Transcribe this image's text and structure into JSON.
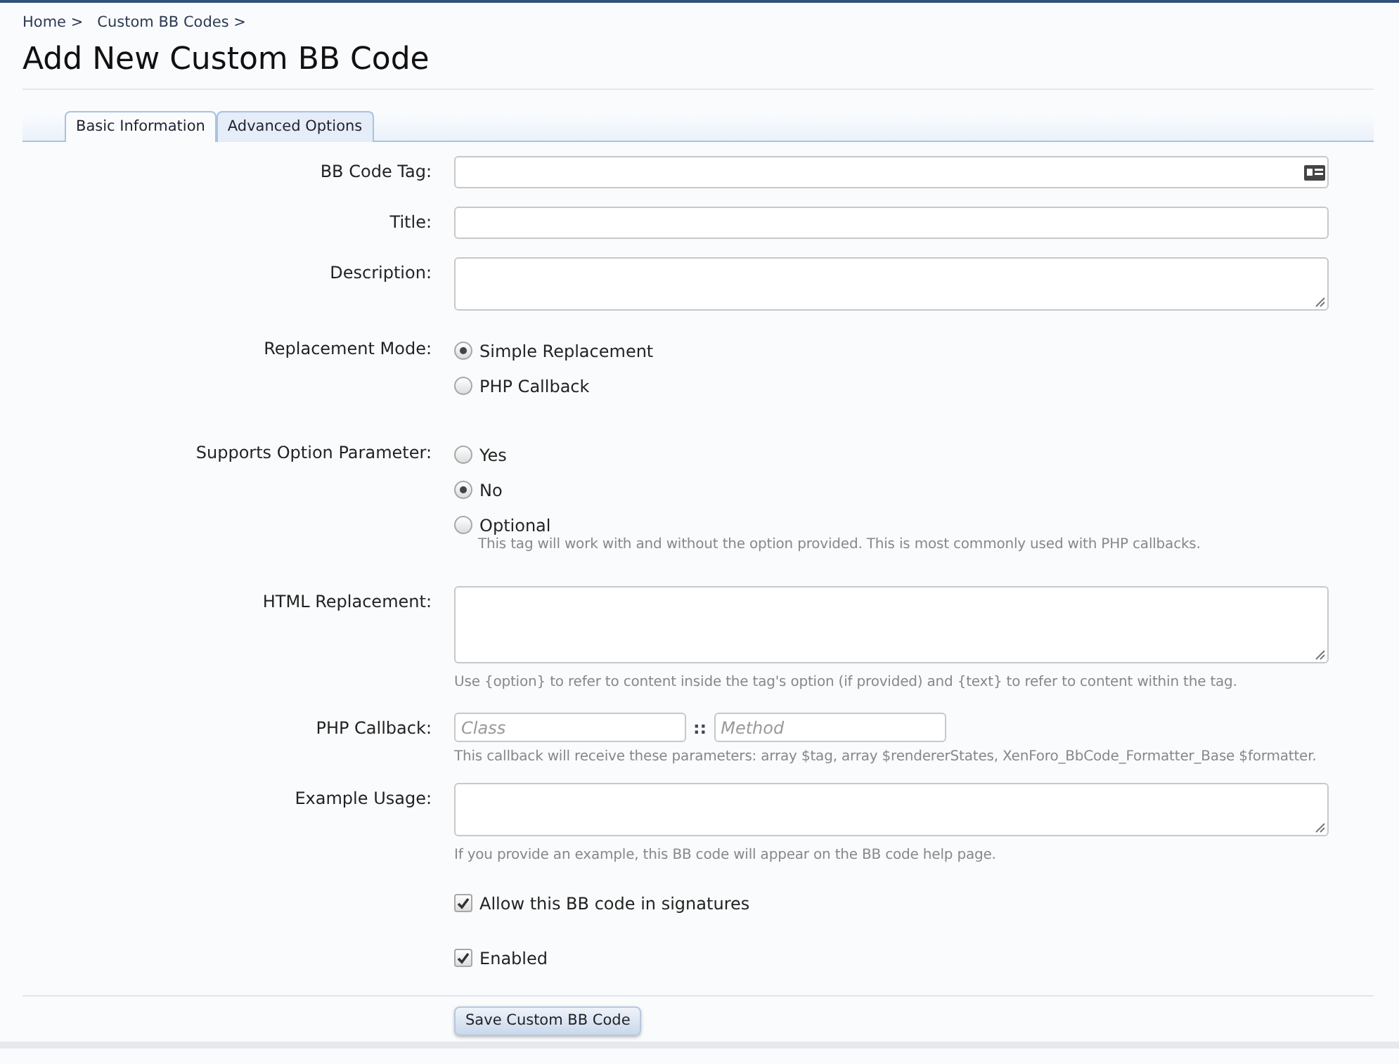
{
  "breadcrumb": [
    "Home >",
    "Custom BB Codes >"
  ],
  "title": "Add New Custom BB Code",
  "tabs": [
    {
      "label": "Basic Information",
      "selected": true
    },
    {
      "label": "Advanced Options",
      "selected": false
    }
  ],
  "fields": [
    {
      "kind": "tag",
      "label": "BB Code Tag:"
    },
    {
      "kind": "text",
      "label": "Title:"
    },
    {
      "kind": "textarea",
      "label": "Description:"
    },
    {
      "kind": "radio",
      "label": "Replacement Mode:",
      "options": [
        {
          "label": "Simple Replacement",
          "selected": true
        },
        {
          "label": "PHP Callback",
          "selected": false
        }
      ]
    },
    {
      "kind": "radio",
      "label": "Supports Option Parameter:",
      "options": [
        {
          "label": "Yes",
          "selected": false
        },
        {
          "label": "No",
          "selected": true
        },
        {
          "label": "Optional",
          "selected": false
        }
      ],
      "hint": "This tag will work with and without the option provided. This is most commonly used with PHP callbacks."
    },
    {
      "kind": "code",
      "label": "HTML Replacement:",
      "hint": "Use {option} to refer to content inside the tag's option (if provided) and {text} to refer to content within the tag."
    },
    {
      "kind": "callback",
      "label": "PHP Callback:",
      "class_placeholder": "Class",
      "separator": "::",
      "method_placeholder": "Method",
      "hint": "This callback will receive these parameters: array $tag, array $rendererStates, XenForo_BbCode_Formatter_Base $formatter."
    },
    {
      "kind": "textarea",
      "label": "Example Usage:",
      "hint": "If you provide an example, this BB code will appear on the BB code help page."
    },
    {
      "kind": "checkbox",
      "label": "Allow this BB code in signatures",
      "checked": true
    },
    {
      "kind": "checkbox",
      "label": "Enabled",
      "checked": true
    }
  ],
  "save_button": "Save Custom BB Code"
}
